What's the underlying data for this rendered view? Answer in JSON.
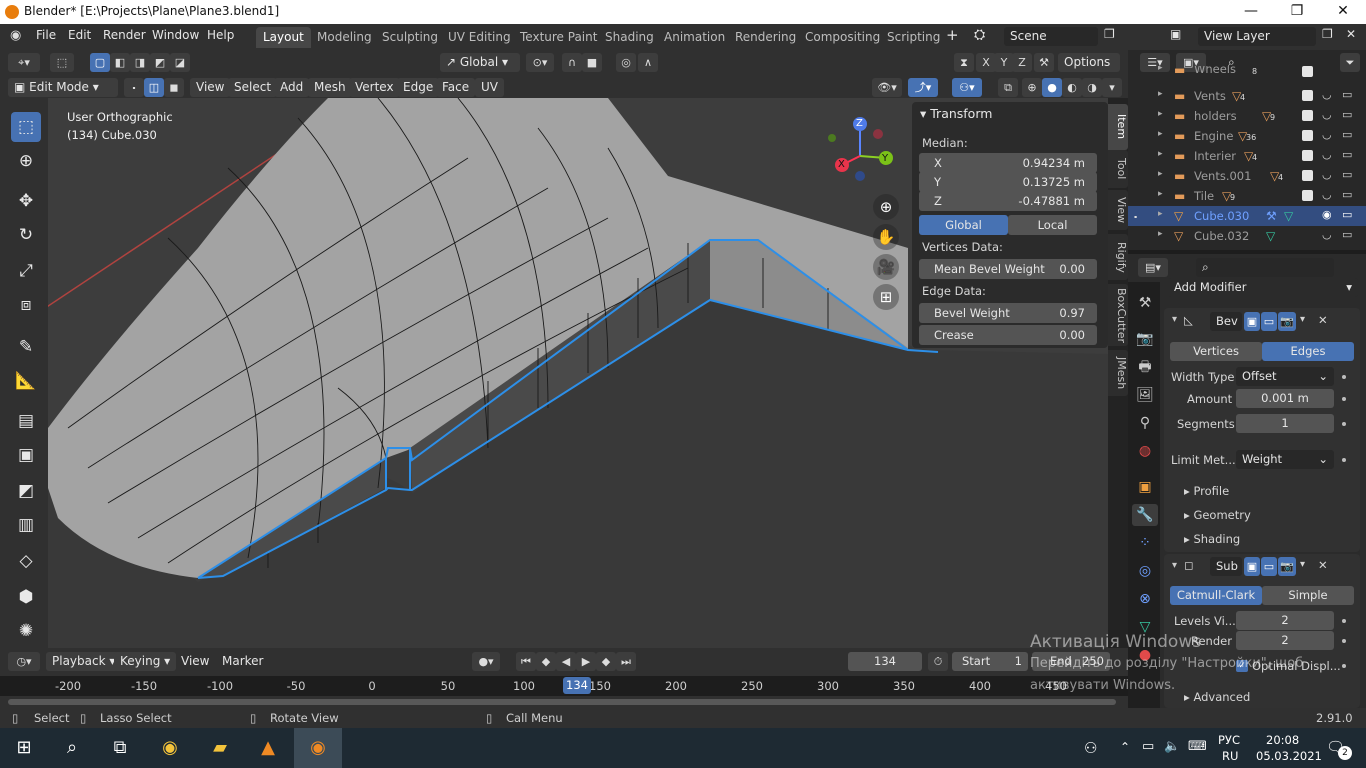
{
  "window": {
    "title": "Blender* [E:\\Projects\\Plane\\Plane3.blend1]",
    "minimize": "—",
    "maximize": "❐",
    "close": "✕"
  },
  "menu": [
    "File",
    "Edit",
    "Render",
    "Window",
    "Help"
  ],
  "workspaces": [
    {
      "label": "Layout",
      "active": true
    },
    {
      "label": "Modeling",
      "active": false
    },
    {
      "label": "Sculpting",
      "active": false
    },
    {
      "label": "UV Editing",
      "active": false
    },
    {
      "label": "Texture Paint",
      "active": false
    },
    {
      "label": "Shading",
      "active": false
    },
    {
      "label": "Animation",
      "active": false
    },
    {
      "label": "Rendering",
      "active": false
    },
    {
      "label": "Compositing",
      "active": false
    },
    {
      "label": "Scripting",
      "active": false
    }
  ],
  "scene": {
    "name": "Scene",
    "view_layer": "View Layer"
  },
  "viewport_header": {
    "transform_orientation": "Global",
    "options": "Options",
    "axes": [
      "X",
      "Y",
      "Z"
    ],
    "mode": "Edit Mode",
    "menus": [
      "View",
      "Select",
      "Add",
      "Mesh",
      "Vertex",
      "Edge",
      "Face",
      "UV"
    ]
  },
  "viewport": {
    "view_name": "User Orthographic",
    "object": "(134) Cube.030"
  },
  "gizmo": {
    "x": "X",
    "y": "Y",
    "z": "Z"
  },
  "npanel": {
    "title": "Transform",
    "median_label": "Median:",
    "x": {
      "label": "X",
      "value": "0.94234 m"
    },
    "y": {
      "label": "Y",
      "value": "0.13725 m"
    },
    "z": {
      "label": "Z",
      "value": "-0.47881 m"
    },
    "global": "Global",
    "local": "Local",
    "vertices_data": "Vertices Data:",
    "mean_bevel_weight": {
      "label": "Mean Bevel Weight",
      "value": "0.00"
    },
    "edge_data": "Edge Data:",
    "bevel_weight": {
      "label": "Bevel Weight",
      "value": "0.97"
    },
    "crease": {
      "label": "Crease",
      "value": "0.00"
    }
  },
  "side_tabs": [
    "Item",
    "Tool",
    "View",
    "Rigify",
    "BoxCutter",
    "JMesh"
  ],
  "timeline": {
    "menus": [
      "Playback",
      "Keying",
      "View",
      "Marker"
    ],
    "current_frame": "134",
    "start_label": "Start",
    "start": "1",
    "end_label": "End",
    "end": "250",
    "ticks": [
      "-200",
      "-150",
      "-100",
      "-50",
      "0",
      "50",
      "100",
      "150",
      "200",
      "250",
      "300",
      "350",
      "400",
      "450"
    ],
    "frame_marker": "134"
  },
  "statusbar": {
    "select": "Select",
    "lasso": "Lasso Select",
    "rotate": "Rotate View",
    "call_menu": "Call Menu",
    "version": "2.91.0"
  },
  "outliner": {
    "rows": [
      {
        "name": "Wheels",
        "badge": "8",
        "selected": false
      },
      {
        "name": "Vents",
        "badge": "4",
        "selected": false
      },
      {
        "name": "holders",
        "badge": "9",
        "selected": false
      },
      {
        "name": "Engine",
        "badge": "36",
        "selected": false
      },
      {
        "name": "Interier",
        "badge": "4",
        "selected": false
      },
      {
        "name": "Vents.001",
        "badge": "4",
        "selected": false
      },
      {
        "name": "Tile",
        "badge": "9",
        "selected": false
      },
      {
        "name": "Cube.030",
        "badge": "",
        "selected": true
      },
      {
        "name": "Cube.032",
        "badge": "",
        "selected": false
      }
    ]
  },
  "properties": {
    "add_modifier": "Add Modifier",
    "bevel": {
      "name": "Bev",
      "vertices": "Vertices",
      "edges": "Edges",
      "width_type_label": "Width Type",
      "width_type": "Offset",
      "amount_label": "Amount",
      "amount": "0.001 m",
      "segments_label": "Segments",
      "segments": "1",
      "limit_label": "Limit Met...",
      "limit": "Weight",
      "profile": "Profile",
      "geometry": "Geometry",
      "shading": "Shading"
    },
    "subsurf": {
      "name": "Sub",
      "catmull": "Catmull-Clark",
      "simple": "Simple",
      "levels_label": "Levels Vi...",
      "levels": "2",
      "render_label": "Render",
      "render": "2",
      "optimal": "Optimal Displ...",
      "advanced": "Advanced"
    }
  },
  "activation": {
    "line1": "Активація Windows",
    "line2": "Перейдіть до розділу \"Настройки\", щоб",
    "line3": "активувати Windows."
  },
  "taskbar": {
    "lang1": "РУС",
    "lang2": "RU",
    "time": "20:08",
    "date": "05.03.2021",
    "notif": "2"
  }
}
